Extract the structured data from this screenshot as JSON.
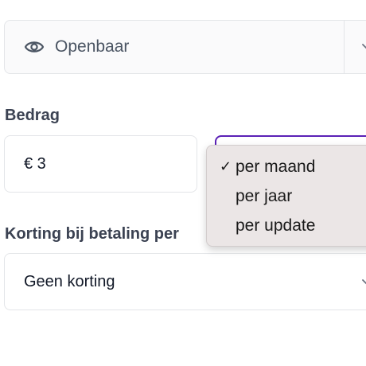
{
  "visibility": {
    "value": "Openbaar",
    "icon": "eye-icon"
  },
  "amount": {
    "label": "Bedrag",
    "value": "€ 3"
  },
  "period": {
    "options": [
      "per maand",
      "per jaar",
      "per update"
    ],
    "selected": "per maand",
    "check_mark": "✓"
  },
  "discount": {
    "label": "Korting bij betaling per",
    "value": "Geen korting"
  },
  "colors": {
    "focus_border": "#5b21b6",
    "menu_background": "#ebe6e6"
  }
}
